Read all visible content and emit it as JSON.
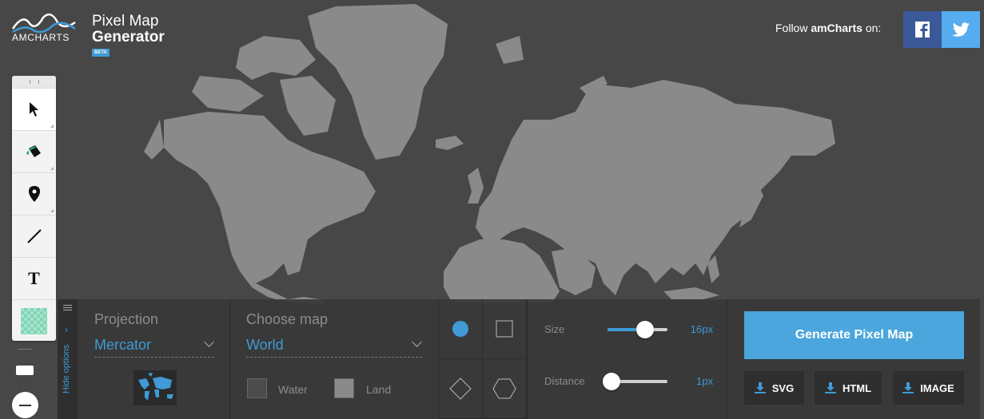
{
  "brand": {
    "logo_text": "AMCHARTS",
    "title_line1": "Pixel Map",
    "title_line2": "Generator",
    "badge": "BETA"
  },
  "social": {
    "follow_prefix": "Follow ",
    "follow_brand": "amCharts",
    "follow_suffix": " on:",
    "facebook_icon": "facebook-icon",
    "twitter_icon": "twitter-icon"
  },
  "toolbar": {
    "tools": [
      "pointer-icon",
      "paint-bucket-icon",
      "map-pin-icon",
      "line-icon",
      "text-icon",
      "color-swatch"
    ],
    "text_tool_label": "T"
  },
  "options": {
    "hide_label": "Hide options",
    "projection": {
      "title": "Projection",
      "value": "Mercator"
    },
    "map": {
      "title": "Choose map",
      "value": "World"
    },
    "colors": {
      "water_label": "Water",
      "land_label": "Land"
    },
    "shapes": [
      "circle",
      "square",
      "diamond",
      "hexagon"
    ],
    "size": {
      "label": "Size",
      "value": "16px",
      "fraction": 0.8
    },
    "distance": {
      "label": "Distance",
      "value": "1px",
      "fraction": 0.0
    }
  },
  "actions": {
    "generate_label": "Generate Pixel Map",
    "export": [
      "SVG",
      "HTML",
      "IMAGE"
    ]
  },
  "colors": {
    "background": "#474747",
    "land": "#8a8a8a",
    "accent": "#3f9ad6",
    "facebook": "#3b5998",
    "twitter": "#55acee"
  }
}
